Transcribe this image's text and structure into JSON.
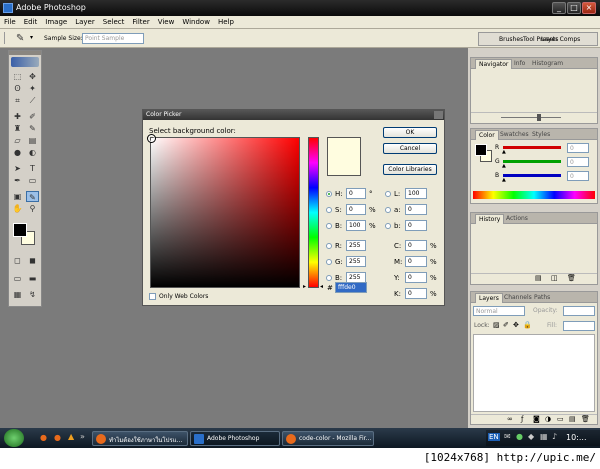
{
  "window": {
    "title": "Adobe Photoshop"
  },
  "menu": [
    "File",
    "Edit",
    "Image",
    "Layer",
    "Select",
    "Filter",
    "View",
    "Window",
    "Help"
  ],
  "options_bar": {
    "sample_size_label": "Sample Size:",
    "sample_size_value": "Point Sample",
    "palette_well_tabs": [
      "Brushes",
      "Tool Presets",
      "Layer Comps"
    ]
  },
  "navigator_panel": {
    "tabs": [
      "Navigator",
      "Info",
      "Histogram"
    ]
  },
  "color_panel": {
    "tabs": [
      "Color",
      "Swatches",
      "Styles"
    ],
    "channels": [
      {
        "label": "R",
        "value": "0",
        "color": "#d00000"
      },
      {
        "label": "G",
        "value": "0",
        "color": "#00a000"
      },
      {
        "label": "B",
        "value": "0",
        "color": "#0000c0"
      }
    ]
  },
  "history_panel": {
    "tabs": [
      "History",
      "Actions"
    ]
  },
  "layers_panel": {
    "tabs": [
      "Layers",
      "Channels",
      "Paths"
    ],
    "blend_mode": "Normal",
    "opacity_label": "Opacity:",
    "lock_label": "Lock:",
    "fill_label": "Fill:"
  },
  "color_picker": {
    "title": "Color Picker",
    "heading": "Select background color:",
    "ok_label": "OK",
    "cancel_label": "Cancel",
    "libraries_label": "Color Libraries",
    "only_web_colors": "Only Web Colors",
    "new_color": "#fffde0",
    "hex_value": "fffde0",
    "fields_left": [
      {
        "label": "H:",
        "value": "0",
        "unit": "°",
        "selected": true
      },
      {
        "label": "S:",
        "value": "0",
        "unit": "%",
        "selected": false
      },
      {
        "label": "B:",
        "value": "100",
        "unit": "%",
        "selected": false
      },
      {
        "label": "R:",
        "value": "255",
        "unit": "",
        "selected": false
      },
      {
        "label": "G:",
        "value": "255",
        "unit": "",
        "selected": false
      },
      {
        "label": "B:",
        "value": "255",
        "unit": "",
        "selected": false
      }
    ],
    "fields_right": [
      {
        "label": "L:",
        "value": "100",
        "unit": ""
      },
      {
        "label": "a:",
        "value": "0",
        "unit": ""
      },
      {
        "label": "b:",
        "value": "0",
        "unit": ""
      },
      {
        "label": "C:",
        "value": "0",
        "unit": "%"
      },
      {
        "label": "M:",
        "value": "0",
        "unit": "%"
      },
      {
        "label": "Y:",
        "value": "0",
        "unit": "%"
      },
      {
        "label": "K:",
        "value": "0",
        "unit": "%"
      }
    ],
    "hex_label": "#"
  },
  "taskbar": {
    "items": [
      {
        "label": "ทำไมต้องใช้ภาษาในโปรแ..."
      },
      {
        "label": "Adobe Photoshop"
      },
      {
        "label": "code-color - Mozilla Fir..."
      }
    ],
    "clock": "10:..."
  },
  "watermark": "[1024x768] http://upic.me/"
}
